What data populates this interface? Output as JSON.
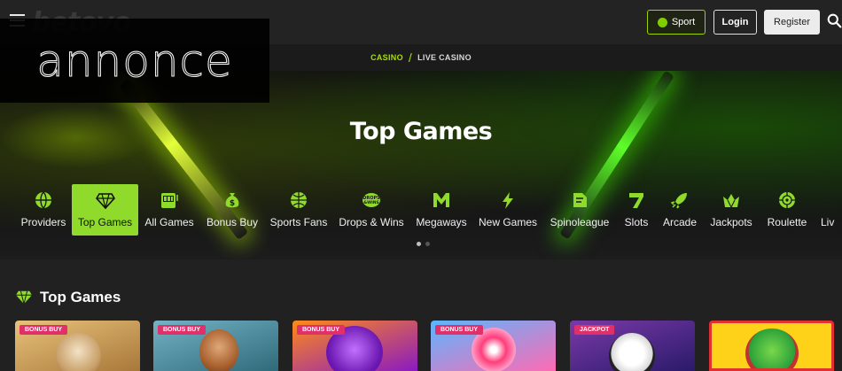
{
  "header": {
    "logo": "betovo",
    "sport_label": "Sport",
    "login_label": "Login",
    "register_label": "Register"
  },
  "ad": {
    "text": "annonce"
  },
  "breadcrumb": {
    "casino": "CASINO",
    "separator": "/",
    "current": "LIVE CASINO"
  },
  "hero": {
    "title": "Top Games"
  },
  "categories": [
    {
      "label": "Providers",
      "icon": "globe-icon"
    },
    {
      "label": "Top Games",
      "icon": "diamond-icon",
      "active": true
    },
    {
      "label": "All Games",
      "icon": "slot-machine-icon"
    },
    {
      "label": "Bonus Buy",
      "icon": "money-bag-icon"
    },
    {
      "label": "Sports Fans",
      "icon": "ball-icon"
    },
    {
      "label": "Drops & Wins",
      "icon": "drops-wins-icon"
    },
    {
      "label": "Megaways",
      "icon": "megaways-icon"
    },
    {
      "label": "New Games",
      "icon": "lightning-icon"
    },
    {
      "label": "Spinoleague",
      "icon": "spinoleague-icon"
    },
    {
      "label": "Slots",
      "icon": "seven-icon"
    },
    {
      "label": "Arcade",
      "icon": "rocket-icon"
    },
    {
      "label": "Jackpots",
      "icon": "crown-icon"
    },
    {
      "label": "Roulette",
      "icon": "roulette-icon"
    },
    {
      "label": "Liv",
      "icon": "live-icon"
    }
  ],
  "carousel": {
    "pages": 2,
    "current": 1
  },
  "section": {
    "title": "Top Games",
    "icon": "diamond-icon"
  },
  "games": [
    {
      "badge": "BONUS BUY",
      "bg": "#b78a4a"
    },
    {
      "badge": "BONUS BUY",
      "bg": "#3a7a8c"
    },
    {
      "badge": "BONUS BUY",
      "bg": "#6a1fa0"
    },
    {
      "badge": "BONUS BUY",
      "bg": "#c24aa6"
    },
    {
      "badge": "JACKPOT",
      "bg": "#3b2a8a"
    },
    {
      "badge": "",
      "bg": "#d93030"
    }
  ],
  "colors": {
    "accent": "#8fda2a",
    "badge": "#e0306a"
  }
}
